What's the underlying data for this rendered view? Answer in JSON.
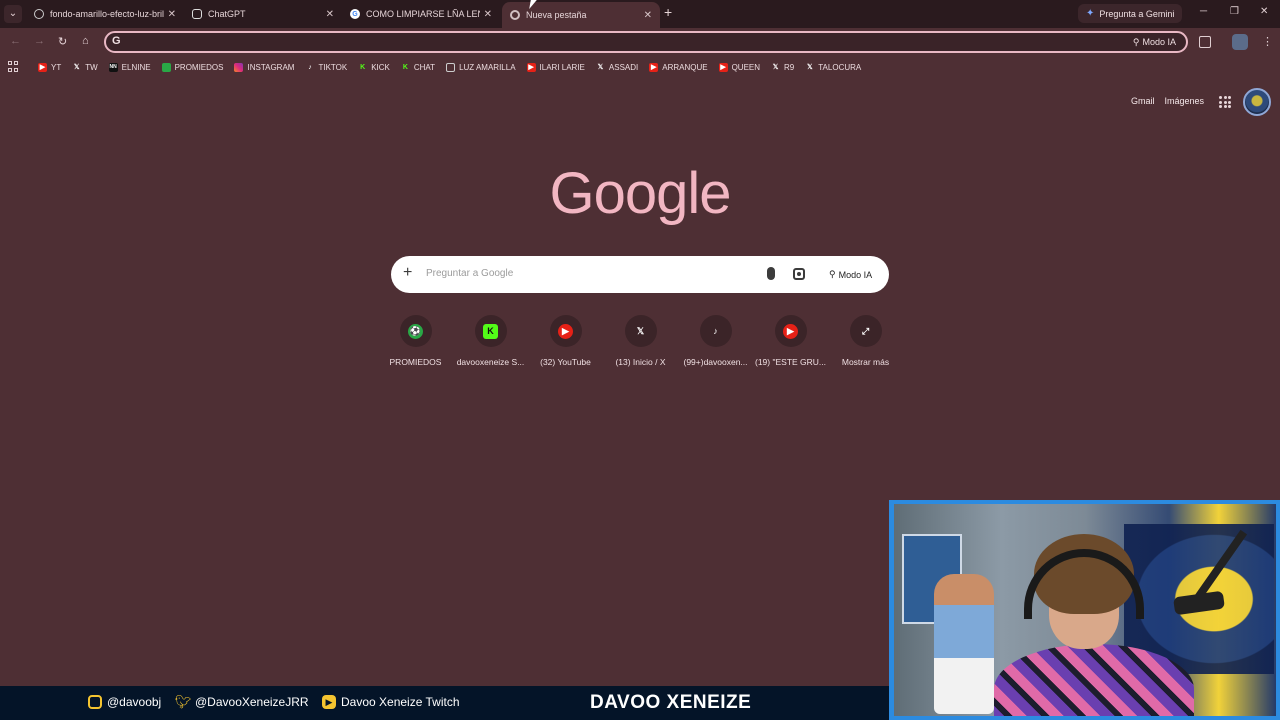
{
  "browser": {
    "tabs": [
      {
        "title": "fondo-amarillo-efecto-luz-brill",
        "icon": "globe-icon"
      },
      {
        "title": "ChatGPT",
        "icon": "chatgpt-icon"
      },
      {
        "title": "COMO LIMPIARSE LÑA LENGUA",
        "icon": "google-icon"
      },
      {
        "title": "Nueva pestaña",
        "icon": "chrome-icon",
        "active": true
      }
    ],
    "gemini_button": "Pregunta a Gemini",
    "omnibox": {
      "value": "",
      "modo_ia": "Modo IA"
    },
    "bookmarks": [
      {
        "label": "YT",
        "icon": "youtube-icon"
      },
      {
        "label": "TW",
        "icon": "x-icon"
      },
      {
        "label": "ELNINE",
        "icon": "elnine-icon"
      },
      {
        "label": "PROMIEDOS",
        "icon": "promiedos-icon"
      },
      {
        "label": "INSTAGRAM",
        "icon": "instagram-icon"
      },
      {
        "label": "TIKTOK",
        "icon": "tiktok-icon"
      },
      {
        "label": "KICK",
        "icon": "kick-icon"
      },
      {
        "label": "CHAT",
        "icon": "kick-icon"
      },
      {
        "label": "LUZ AMARILLA",
        "icon": "globe-icon"
      },
      {
        "label": "ILARI LARIE",
        "icon": "youtube-icon"
      },
      {
        "label": "ASSADI",
        "icon": "x-icon"
      },
      {
        "label": "ARRANQUE",
        "icon": "youtube-icon"
      },
      {
        "label": "QUEEN",
        "icon": "youtube-icon"
      },
      {
        "label": "R9",
        "icon": "x-icon"
      },
      {
        "label": "TALOCURA",
        "icon": "x-icon"
      }
    ]
  },
  "newtab": {
    "links": {
      "gmail": "Gmail",
      "images": "Imágenes"
    },
    "logo": "Google",
    "search": {
      "placeholder": "Preguntar a Google",
      "modo_ia": "Modo IA"
    },
    "shortcuts": [
      {
        "label": "PROMIEDOS",
        "icon": "promiedos-icon"
      },
      {
        "label": "davooxeneize S...",
        "icon": "kick-icon"
      },
      {
        "label": "(32) YouTube",
        "icon": "youtube-icon"
      },
      {
        "label": "(13) Inicio / X",
        "icon": "x-icon"
      },
      {
        "label": "(99+)davooxen...",
        "icon": "tiktok-icon"
      },
      {
        "label": "(19) \"ESTE GRU...",
        "icon": "youtube-icon"
      },
      {
        "label": "Mostrar más",
        "icon": "expand-icon"
      }
    ]
  },
  "overlay": {
    "instagram": "@davoobj",
    "twitter": "@DavooXeneizeJRR",
    "twitch": "Davoo Xeneize Twitch",
    "brand": "DAVOO XENEIZE"
  },
  "colors": {
    "background": "#4e2f34",
    "accent": "#f2b6c2",
    "overlay_bar": "#041428",
    "overlay_accent": "#f4c430"
  }
}
